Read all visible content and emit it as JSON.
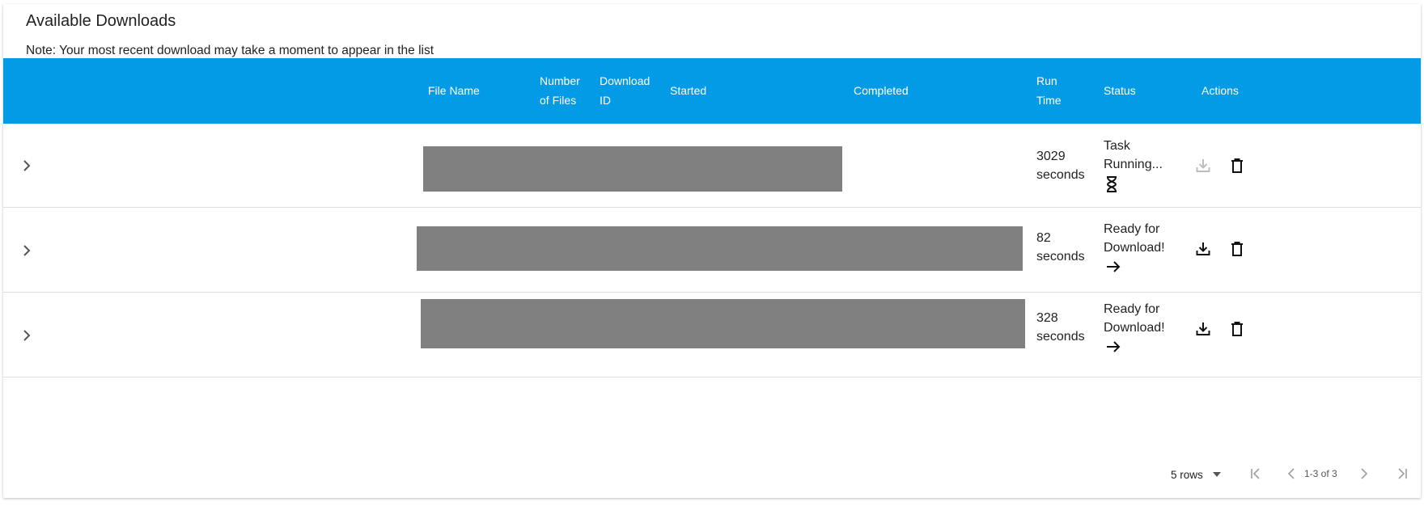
{
  "header": {
    "title": "Available Downloads",
    "note": "Note: Your most recent download may take a moment to appear in the list"
  },
  "table": {
    "columns": {
      "file_name": "File Name",
      "number_of_files": [
        "Number",
        "of Files"
      ],
      "download_id": [
        "Download",
        "ID"
      ],
      "started": "Started",
      "completed": "Completed",
      "run_time": [
        "Run",
        "Time"
      ],
      "status": "Status",
      "actions": "Actions"
    },
    "rows": [
      {
        "run_time": [
          "3029",
          "seconds"
        ],
        "status": [
          "Task",
          "Running..."
        ],
        "status_icon": "hourglass-icon",
        "download_enabled": false
      },
      {
        "run_time": [
          "82",
          "seconds"
        ],
        "status": [
          "Ready for",
          "Download!"
        ],
        "status_icon": "arrow-right-icon",
        "download_enabled": true
      },
      {
        "run_time": [
          "328",
          "seconds"
        ],
        "status": [
          "Ready for",
          "Download!"
        ],
        "status_icon": "arrow-right-icon",
        "download_enabled": true
      }
    ]
  },
  "pagination": {
    "rows_per_page": "5 rows",
    "range": "1-3 of 3"
  },
  "colors": {
    "header_bg": "#039be5",
    "redaction": "#808080",
    "disabled_icon": "#bdbdbd"
  }
}
